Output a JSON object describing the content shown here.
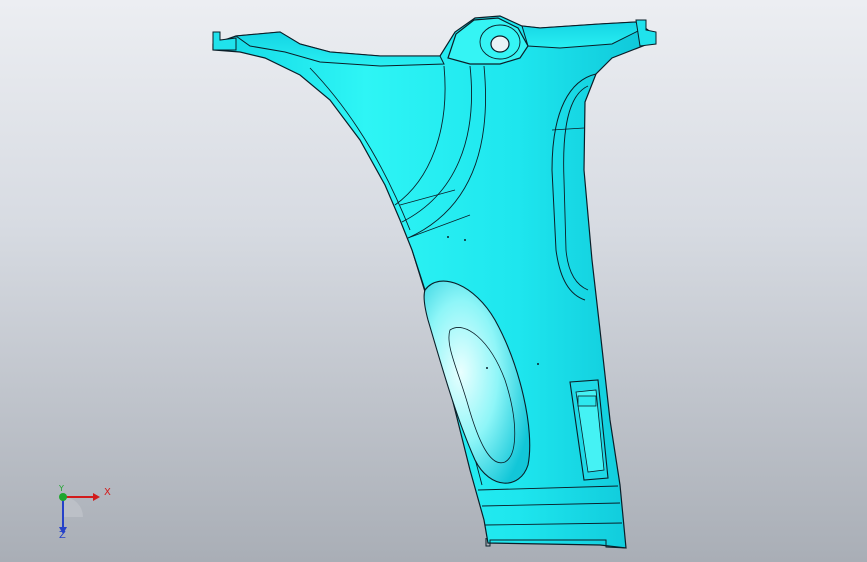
{
  "viewport": {
    "background_top": "#eceef2",
    "background_bottom": "#a9aeb6"
  },
  "model": {
    "surface_color": "#26f0f0",
    "edge_color": "#0a1e28"
  },
  "triad": {
    "x_label": "X",
    "y_label": "Y",
    "z_label": "Z",
    "x_color": "#d21b1b",
    "y_color": "#1fa62e",
    "z_color": "#2541c9"
  }
}
